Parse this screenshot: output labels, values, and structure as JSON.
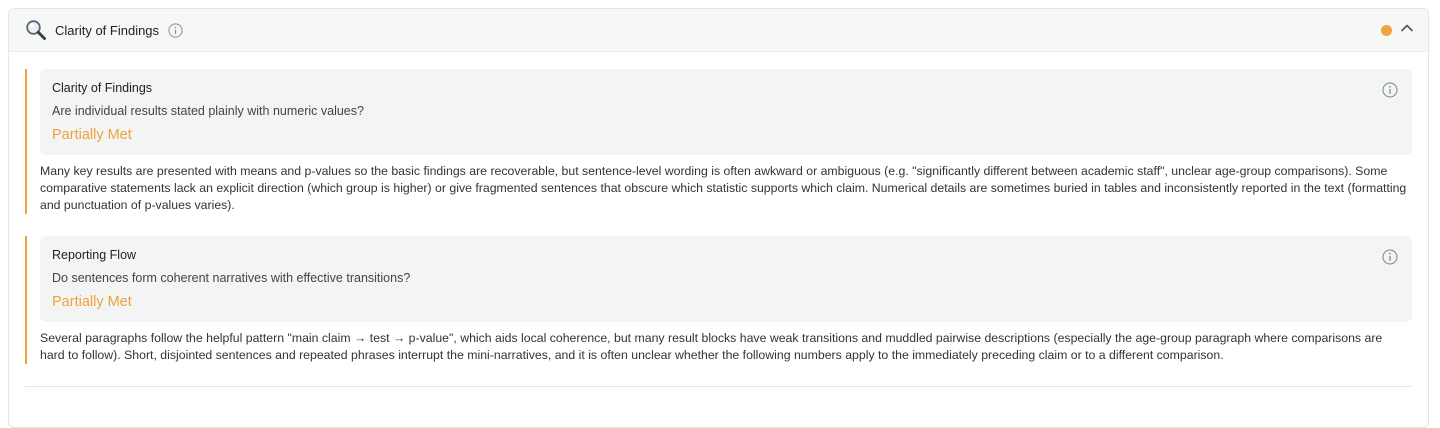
{
  "colors": {
    "accent": "#f0a33a",
    "status_partial": "#f0a33a"
  },
  "header": {
    "title": "Clarity of Findings",
    "icon": "magnifier-icon"
  },
  "criteria": [
    {
      "title": "Clarity of Findings",
      "question": "Are individual results stated plainly with numeric values?",
      "status": "Partially Met",
      "explanation": "Many key results are presented with means and p-values so the basic findings are recoverable, but sentence-level wording is often awkward or ambiguous (e.g. \"significantly different between academic staff\", unclear age-group comparisons). Some comparative statements lack an explicit direction (which group is higher) or give fragmented sentences that obscure which statistic supports which claim. Numerical details are sometimes buried in tables and inconsistently reported in the text (formatting and punctuation of p-values varies)."
    },
    {
      "title": "Reporting Flow",
      "question": "Do sentences form coherent narratives with effective transitions?",
      "status": "Partially Met",
      "explanation": "Several paragraphs follow the helpful pattern \"main claim → test → p-value\", which aids local coherence, but many result blocks have weak transitions and muddled pairwise descriptions (especially the age-group paragraph where comparisons are hard to follow). Short, disjointed sentences and repeated phrases interrupt the mini-narratives, and it is often unclear whether the following numbers apply to the immediately preceding claim or to a different comparison."
    }
  ]
}
